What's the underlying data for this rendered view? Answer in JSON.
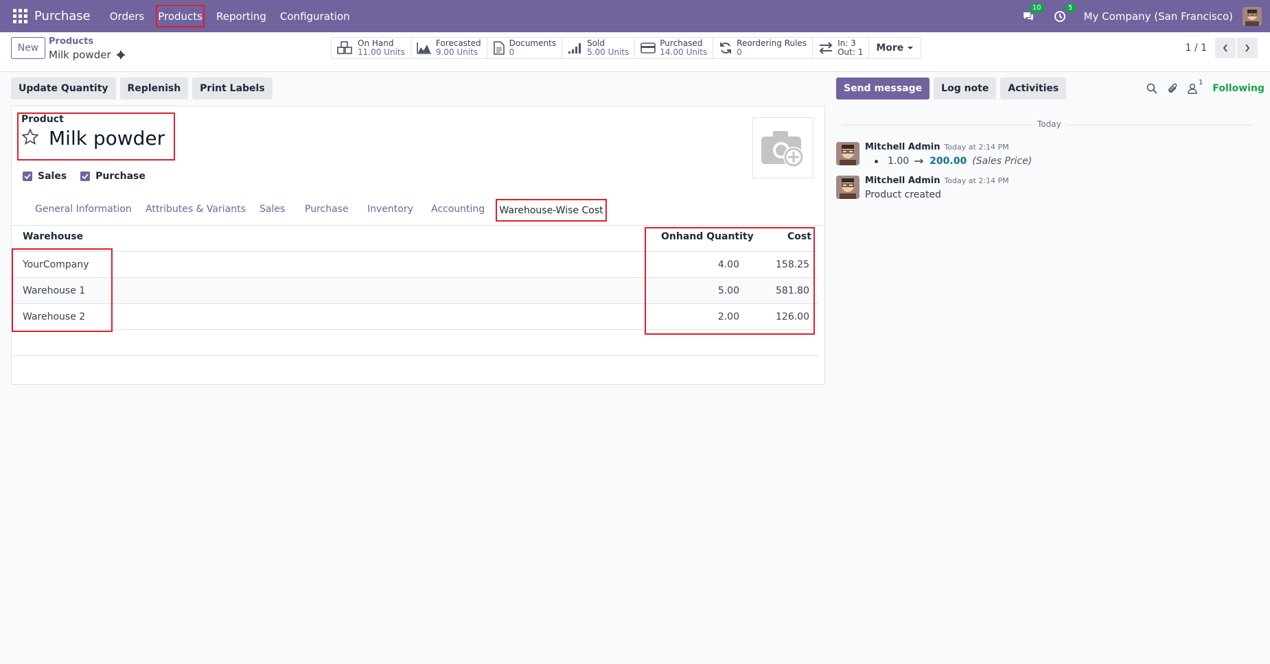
{
  "navbar": {
    "app_title": "Purchase",
    "menu": [
      "Orders",
      "Products",
      "Reporting",
      "Configuration"
    ],
    "messages_badge": "10",
    "activities_badge": "5",
    "company": "My Company (San Francisco)"
  },
  "control": {
    "new_label": "New",
    "breadcrumb_parent": "Products",
    "breadcrumb_current": "Milk powder",
    "stats": [
      {
        "label": "On Hand",
        "value": "11.00 Units",
        "icon": "cubes-icon"
      },
      {
        "label": "Forecasted",
        "value": "9.00 Units",
        "icon": "area-chart-icon"
      },
      {
        "label": "Documents",
        "value": "0",
        "icon": "document-icon"
      },
      {
        "label": "Sold",
        "value": "5.00 Units",
        "icon": "signal-icon"
      },
      {
        "label": "Purchased",
        "value": "14.00 Units",
        "icon": "credit-card-icon"
      },
      {
        "label": "Reordering Rules",
        "value": "0",
        "icon": "refresh-icon"
      },
      {
        "label": "In: 3",
        "value": "Out: 1",
        "icon": "exchange-icon"
      }
    ],
    "more_label": "More",
    "pager": "1 / 1"
  },
  "actions": [
    "Update Quantity",
    "Replenish",
    "Print Labels"
  ],
  "form": {
    "product_label": "Product",
    "product_name": "Milk powder",
    "checkboxes": [
      {
        "label": "Sales",
        "checked": true
      },
      {
        "label": "Purchase",
        "checked": true
      }
    ],
    "tabs": [
      "General Information",
      "Attributes & Variants",
      "Sales",
      "Purchase",
      "Inventory",
      "Accounting"
    ],
    "active_tab": "Warehouse-Wise Cost",
    "table": {
      "headers": [
        "Warehouse",
        "Onhand Quantity",
        "Cost"
      ],
      "rows": [
        {
          "warehouse": "YourCompany",
          "qty": "4.00",
          "cost": "158.25"
        },
        {
          "warehouse": "Warehouse 1",
          "qty": "5.00",
          "cost": "581.80"
        },
        {
          "warehouse": "Warehouse 2",
          "qty": "2.00",
          "cost": "126.00"
        }
      ]
    }
  },
  "chatter": {
    "send_message": "Send message",
    "log_note": "Log note",
    "activities": "Activities",
    "followers_count": "1",
    "following": "Following",
    "today": "Today",
    "messages": [
      {
        "author": "Mitchell Admin",
        "time": "Today at 2:14 PM",
        "old_value": "1.00",
        "new_value": "200.00",
        "field": "(Sales Price)"
      },
      {
        "author": "Mitchell Admin",
        "time": "Today at 2:14 PM",
        "body": "Product created"
      }
    ]
  },
  "colors": {
    "brand": "#71639e",
    "highlight": "#e11d2c",
    "following": "#16a34a"
  }
}
